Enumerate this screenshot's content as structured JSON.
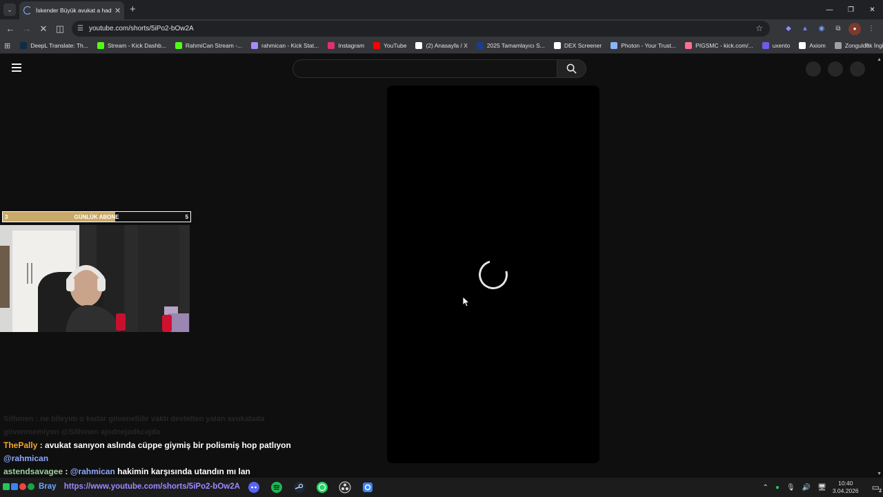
{
  "browser": {
    "tab_title": "İskender Büyük avukat a had b",
    "url": "youtube.com/shorts/5iPo2-bOw2A",
    "bookmarks": [
      {
        "label": "DeepL Translate: Th...",
        "icon": "deepl-icon",
        "color": "#0f2b46"
      },
      {
        "label": "Stream - Kick Dashb...",
        "icon": "kick-icon",
        "color": "#53fc18"
      },
      {
        "label": "RahmiCan Stream -...",
        "icon": "kick-icon",
        "color": "#53fc18"
      },
      {
        "label": "rahmican - Kick Stat...",
        "icon": "kickstats-icon",
        "color": "#a78bfa"
      },
      {
        "label": "Instagram",
        "icon": "instagram-icon",
        "color": "#e1306c"
      },
      {
        "label": "YouTube",
        "icon": "youtube-icon",
        "color": "#ff0000"
      },
      {
        "label": "(2) Anasayfa / X",
        "icon": "x-icon",
        "color": "#ffffff"
      },
      {
        "label": "2025 Tamamlayıcı S...",
        "icon": "globe-icon",
        "color": "#1a3d8f"
      },
      {
        "label": "DEX Screener",
        "icon": "dex-icon",
        "color": "#ffffff"
      },
      {
        "label": "Photon - Your Trust...",
        "icon": "photon-icon",
        "color": "#8ab4f8"
      },
      {
        "label": "PIGSMC - kick.com/...",
        "icon": "pig-icon",
        "color": "#ff6f91"
      },
      {
        "label": "uxento",
        "icon": "uxento-icon",
        "color": "#6c5ce7"
      },
      {
        "label": "Axiom",
        "icon": "axiom-icon",
        "color": "#ffffff"
      },
      {
        "label": "Zonguldak İngilizce...",
        "icon": "zonguldak-icon",
        "color": "#a0a0a0"
      }
    ]
  },
  "overlay": {
    "sub_left": "3",
    "sub_title": "GÜNLÜK ABONE",
    "sub_right": "5",
    "sub_progress": 0.6
  },
  "chat": {
    "faded_1_user": "Sithmen",
    "faded_1_text": ": ne bileyim o kadar güvenelidir vaktı devletten yalan avukatada",
    "faded_2_text": "güvenmemiyon",
    "faded_2_mention": "@Sithmen",
    "faded_2_tail": "ajodnejodkcajda",
    "line1_user": "ThePally",
    "line1_text": ": avukat sanıyon aslında cüppe giymiş bir polismiş hop patlıyon",
    "line1_mention": "@rahmican",
    "line2_user": "astendsavagee",
    "line2_sep": ":",
    "line2_mention": "@rahmican",
    "line2_text": "hakimin karşısında utandın mı lan"
  },
  "taskbar": {
    "ticker_user": "Bray",
    "ticker_text": "https://www.youtube.com/shorts/5iPo2-bOw2A",
    "time": "10:40",
    "date": "3.04.2026",
    "notification_count": "2"
  }
}
